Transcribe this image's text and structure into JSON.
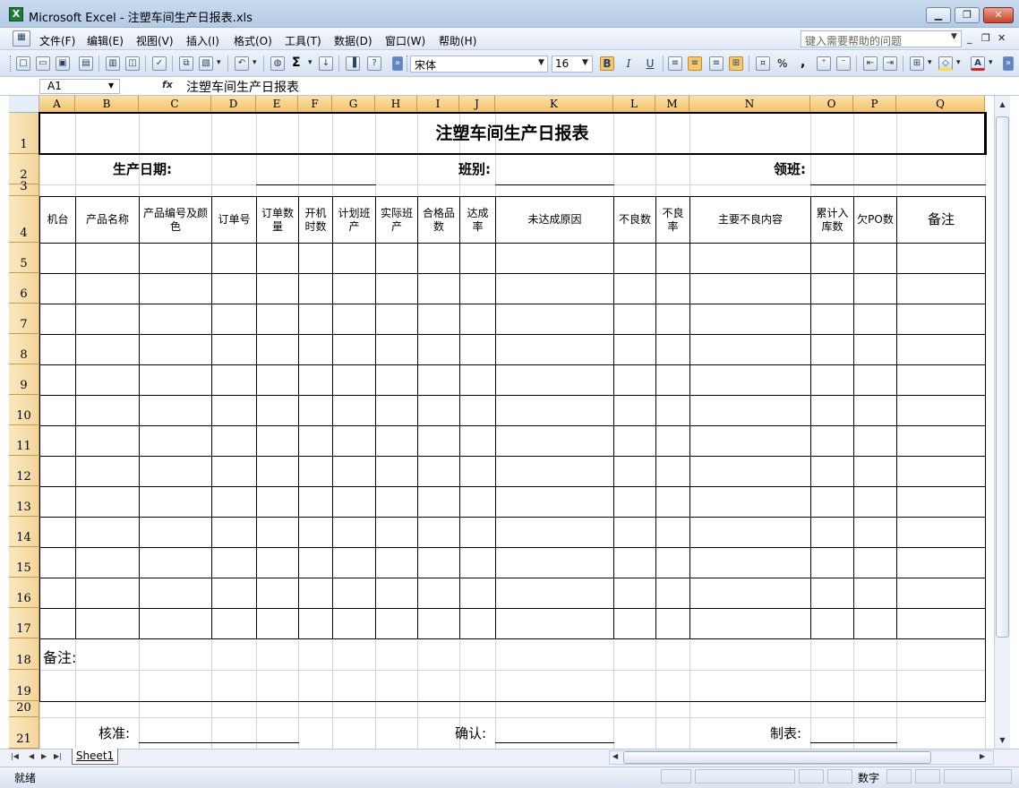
{
  "window": {
    "title": "Microsoft Excel - 注塑车间生产日报表.xls",
    "app_icon": "excel-icon"
  },
  "window_controls": [
    "minimize-icon",
    "restore-icon",
    "close-icon"
  ],
  "menu": [
    "文件(F)",
    "编辑(E)",
    "视图(V)",
    "插入(I)",
    "格式(O)",
    "工具(T)",
    "数据(D)",
    "窗口(W)",
    "帮助(H)"
  ],
  "help": {
    "placeholder": "键入需要帮助的问题"
  },
  "toolbar": {
    "font": "宋体",
    "size": "16",
    "bold": "B",
    "italic": "I",
    "underline": "U",
    "sum": "Σ",
    "percent": "%",
    "comma": ","
  },
  "formula_bar": {
    "cell": "A1",
    "fx": "fx",
    "value": "注塑车间生产日报表"
  },
  "columns": [
    "A",
    "B",
    "C",
    "D",
    "E",
    "F",
    "G",
    "H",
    "I",
    "J",
    "K",
    "L",
    "M",
    "N",
    "O",
    "P",
    "Q"
  ],
  "rows": [
    "1",
    "2",
    "3",
    "4",
    "5",
    "6",
    "7",
    "8",
    "9",
    "10",
    "11",
    "12",
    "13",
    "14",
    "15",
    "16",
    "17",
    "18",
    "19",
    "20",
    "21"
  ],
  "sheet": {
    "title": "注塑车间生产日报表",
    "production_date_label": "生产日期:",
    "shift_label": "班别:",
    "leader_label": "领班:",
    "headers": [
      "机台",
      "产品名称",
      "产品编号及颜色",
      "订单号",
      "订单数量",
      "开机时数",
      "计划班产",
      "实际班产",
      "合格品数",
      "达成率",
      "未达成原因",
      "不良数",
      "不良率",
      "主要不良内容",
      "累计入库数",
      "欠PO数",
      "备注"
    ],
    "remarks_label": "备注:",
    "approve_label": "核准:",
    "confirm_label": "确认:",
    "prepared_label": "制表:"
  },
  "sheet_tabs": [
    "Sheet1"
  ],
  "status": {
    "ready": "就绪",
    "num": "数字"
  }
}
